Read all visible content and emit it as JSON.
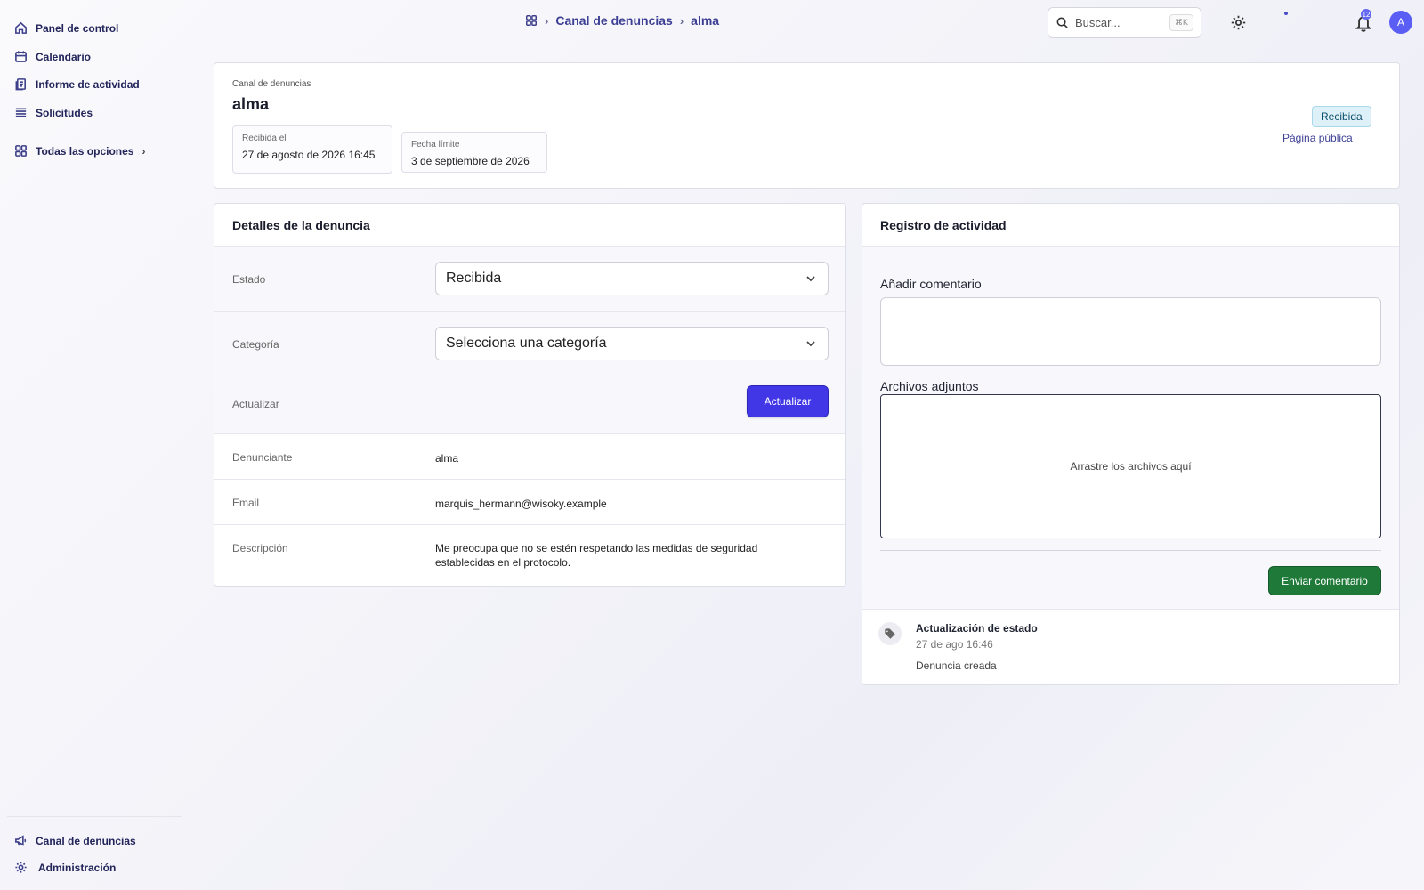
{
  "sidebar": {
    "items": [
      {
        "label": "Panel de control",
        "icon": "home-icon"
      },
      {
        "label": "Calendario",
        "icon": "calendar-icon"
      },
      {
        "label": "Informe de actividad",
        "icon": "report-icon"
      },
      {
        "label": "Solicitudes",
        "icon": "list-icon"
      },
      {
        "label": "Todas las opciones",
        "icon": "grid-icon"
      }
    ],
    "bottom": [
      {
        "label": "Canal de denuncias",
        "icon": "megaphone-icon"
      },
      {
        "label": "Administración",
        "icon": "gear-icon"
      }
    ]
  },
  "topbar": {
    "breadcrumb": [
      "Canal de denuncias",
      "alma"
    ],
    "search_placeholder": "Buscar...",
    "search_shortcut": "⌘K",
    "notification_count": "12",
    "avatar_initial": "A"
  },
  "header": {
    "caption": "Canal de denuncias",
    "title": "alma",
    "received_label": "Recibida el",
    "received_value": "27 de agosto de 2026 16:45",
    "deadline_label": "Fecha límite",
    "deadline_value": "3 de septiembre de 2026",
    "status": "Recibida",
    "public_link": "Página pública"
  },
  "details": {
    "title": "Detalles de la denuncia",
    "status_label": "Estado",
    "status_value": "Recibida",
    "category_label": "Categoría",
    "category_value": "Selecciona una categoría",
    "update_label": "Actualizar",
    "update_button": "Actualizar",
    "reporter_label": "Denunciante",
    "reporter_value": "alma",
    "email_label": "Email",
    "email_value": "marquis_hermann@wisoky.example",
    "description_label": "Descripción",
    "description_value": "Me preocupa que no se estén respetando las medidas de seguridad establecidas en el protocolo."
  },
  "activity": {
    "title": "Registro de actividad",
    "comment_label": "Añadir comentario",
    "attachments_label": "Archivos adjuntos",
    "dropzone_text": "Arrastre los archivos aquí",
    "submit_button": "Enviar comentario",
    "log": {
      "title": "Actualización de estado",
      "time": "27 de ago 16:46",
      "text": "Denuncia creada"
    }
  },
  "colors": {
    "primary": "#4137e6",
    "success": "#1f7a3a",
    "status_bg": "#dff1f8"
  }
}
